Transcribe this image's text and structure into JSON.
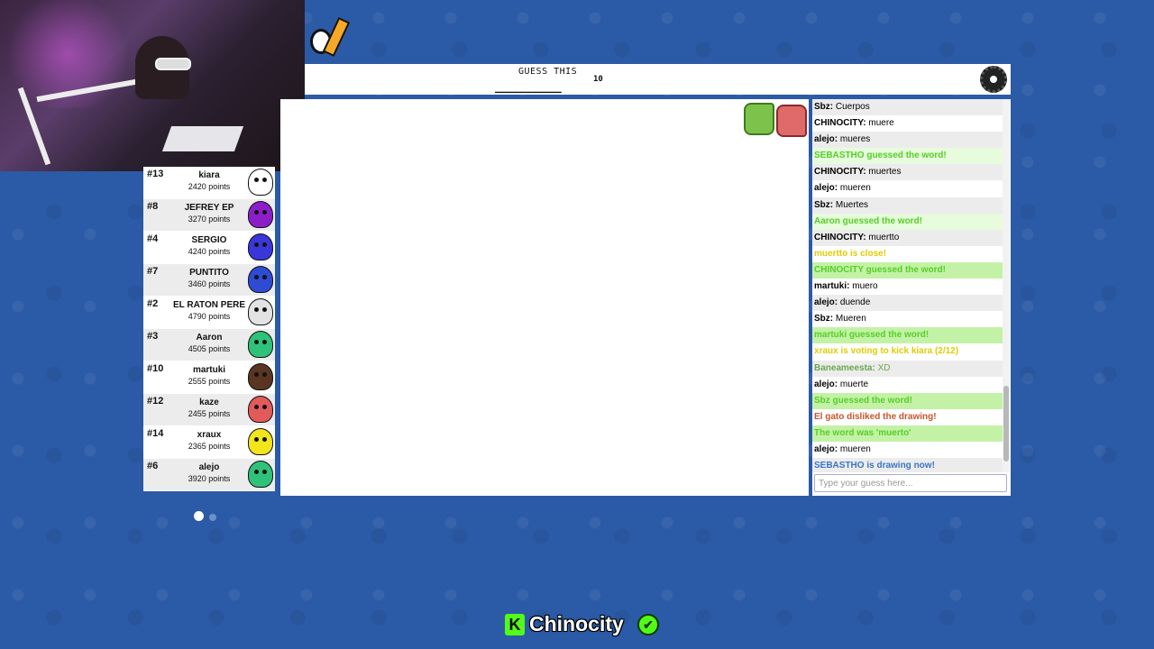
{
  "header": {
    "guess_label": "GUESS THIS",
    "hint": "__________",
    "hint_count": "10"
  },
  "icons": {
    "settings": "gear-icon",
    "like": "thumbs-up-icon",
    "dislike": "thumbs-down-icon"
  },
  "players": [
    {
      "rank": "#13",
      "name": "kiara",
      "points": "2420 points",
      "color": "#ffffff"
    },
    {
      "rank": "#8",
      "name": "JEFREY EP",
      "points": "3270 points",
      "color": "#8b1ec9"
    },
    {
      "rank": "#4",
      "name": "SERGIO",
      "points": "4240 points",
      "color": "#3b36d9"
    },
    {
      "rank": "#7",
      "name": "PUNTITO",
      "points": "3460 points",
      "color": "#2d4bd3"
    },
    {
      "rank": "#2",
      "name": "EL RATON PERE",
      "points": "4790 points",
      "color": "#e3e3e3"
    },
    {
      "rank": "#3",
      "name": "Aaron",
      "points": "4505 points",
      "color": "#2fc27a"
    },
    {
      "rank": "#10",
      "name": "martuki",
      "points": "2555 points",
      "color": "#5a3521"
    },
    {
      "rank": "#12",
      "name": "kaze",
      "points": "2455 points",
      "color": "#e35a5a"
    },
    {
      "rank": "#14",
      "name": "xraux",
      "points": "2365 points",
      "color": "#f2e51c"
    },
    {
      "rank": "#6",
      "name": "alejo",
      "points": "3920 points",
      "color": "#2fc27a"
    }
  ],
  "chat": {
    "messages": [
      {
        "user": "Sbz",
        "text": "Cuerpos",
        "type": "normal"
      },
      {
        "user": "CHINOCITY",
        "text": "muere",
        "type": "normal"
      },
      {
        "user": "alejo",
        "text": "mueres",
        "type": "normal"
      },
      {
        "user": "",
        "text": "SEBASTHO guessed the word!",
        "type": "green"
      },
      {
        "user": "CHINOCITY",
        "text": "muertes",
        "type": "normal"
      },
      {
        "user": "alejo",
        "text": "mueren",
        "type": "normal"
      },
      {
        "user": "Sbz",
        "text": "Muertes",
        "type": "normal"
      },
      {
        "user": "",
        "text": "Aaron guessed the word!",
        "type": "green"
      },
      {
        "user": "CHINOCITY",
        "text": "muertto",
        "type": "normal"
      },
      {
        "user": "",
        "text": "muertto is close!",
        "type": "yellow"
      },
      {
        "user": "",
        "text": "CHINOCITY guessed the word!",
        "type": "green"
      },
      {
        "user": "martuki",
        "text": "muero",
        "type": "normal"
      },
      {
        "user": "alejo",
        "text": "duende",
        "type": "normal"
      },
      {
        "user": "Sbz",
        "text": "Mueren",
        "type": "normal"
      },
      {
        "user": "",
        "text": "martuki guessed the word!",
        "type": "green"
      },
      {
        "user": "",
        "text": "xraux is voting to kick kiara (2/12)",
        "type": "yellow"
      },
      {
        "user": "Baneameesta",
        "text": "XD",
        "type": "greenname"
      },
      {
        "user": "alejo",
        "text": "muerte",
        "type": "normal"
      },
      {
        "user": "",
        "text": "Sbz guessed the word!",
        "type": "green"
      },
      {
        "user": "",
        "text": "El gato disliked the drawing!",
        "type": "orange"
      },
      {
        "user": "",
        "text": "The word was 'muerto'",
        "type": "green"
      },
      {
        "user": "alejo",
        "text": "mueren",
        "type": "normal"
      },
      {
        "user": "",
        "text": "SEBASTHO is drawing now!",
        "type": "blue"
      }
    ],
    "input_placeholder": "Type your guess here..."
  },
  "brand": {
    "name": "Chinocity",
    "k_letter": "K",
    "check": "✔"
  },
  "colors": {
    "background": "#2b5aa6",
    "guessed": "#56ce27",
    "close": "#e2cb00",
    "disliked": "#c8552a",
    "drawing": "#3a75c4",
    "brand": "#53fc18"
  }
}
